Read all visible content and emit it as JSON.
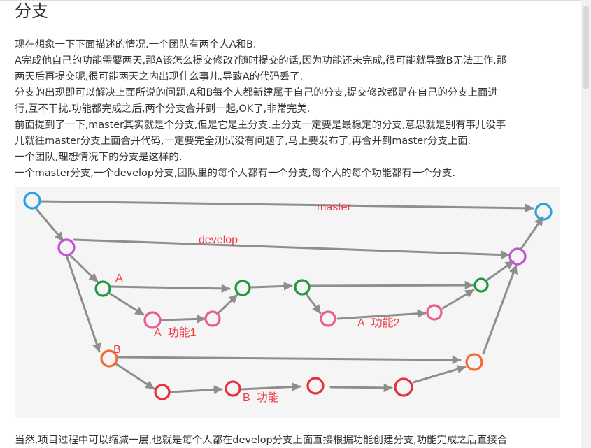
{
  "article": {
    "title": "分支",
    "paragraphs": [
      "现在想象一下下面描述的情况.一个团队有两个人A和B.",
      "A完成他自己的功能需要两天,那A该怎么提交修改?随时提交的话,因为功能还未完成,很可能就导致B无法工作.那",
      "两天后再提交呢,很可能两天之内出现什么事儿,导致A的代码丢了.",
      "分支的出现即可以解决上面所说的问题,A和B每个人都新建属于自己的分支,提交修改都是在自己的分支上面进",
      "行,互不干扰.功能都完成之后,两个分支合并到一起,OK了,非常完美.",
      "前面提到了一下,master其实就是个分支,但是它是主分支.主分支一定要是最稳定的分支,意思就是别有事儿没事",
      "儿就往master分支上面合并代码,一定要完全测试没有问题了,马上要发布了,再合并到master分支上面.",
      "一个团队,理想情况下的分支是这样的.",
      "一个master分支,一个develop分支,团队里的每个人都有一个分支,每个人的每个功能都有一个分支."
    ],
    "bottom_text": "当然,项目过程中可以缩减一层,也就是每个人都在develop分支上面直接根据功能创建分支,功能完成之后直接合"
  },
  "diagram": {
    "labels": {
      "master": "master",
      "develop": "develop",
      "a": "A",
      "a_feature1": "A_功能1",
      "a_feature2": "A_功能2",
      "b": "B",
      "b_feature": "B_功能"
    },
    "colors": {
      "master": "#2aa3dd",
      "develop": "#c152d1",
      "a": "#1c9a3f",
      "a_feature": "#ea5c92",
      "b": "#ef6d35",
      "b_feature": "#e8303c",
      "label": "#ef3b46",
      "arrow": "#8e8e8e",
      "background": "#f5f5f5"
    }
  }
}
